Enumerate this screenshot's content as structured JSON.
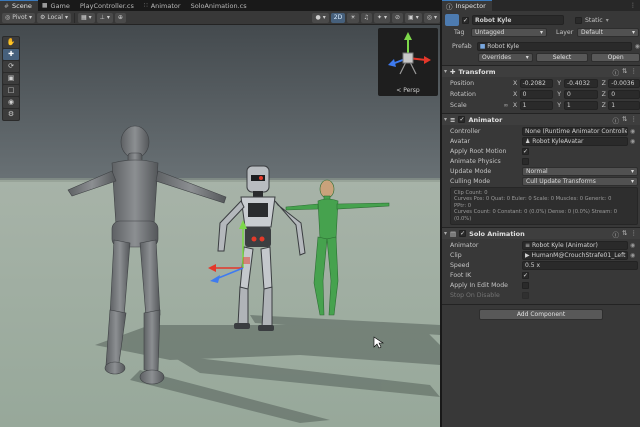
{
  "tabs": [
    {
      "label": "Scene",
      "icon": "#",
      "active": true
    },
    {
      "label": "Game",
      "icon": "■",
      "active": false
    },
    {
      "label": "PlayController.cs",
      "icon": "",
      "active": false
    },
    {
      "label": "Animator",
      "icon": "∷",
      "active": false
    },
    {
      "label": "SoloAnimation.cs",
      "icon": "",
      "active": false
    }
  ],
  "scene_toolbar": {
    "pivot": "Pivot",
    "local": "Local",
    "persp_label": "< Persp"
  },
  "inspector": {
    "tab_label": "Inspector",
    "object_name": "Robot Kyle",
    "static_label": "Static",
    "tag_label": "Tag",
    "tag_value": "Untagged",
    "layer_label": "Layer",
    "layer_value": "Default",
    "prefab_label": "Prefab",
    "prefab_value": "Robot Kyle",
    "overrides_label": "Overrides",
    "select_label": "Select",
    "open_label": "Open",
    "transform": {
      "title": "Transform",
      "position_label": "Position",
      "position": {
        "x": "-0.2082",
        "y": "-0.4032",
        "z": "-0.0036"
      },
      "rotation_label": "Rotation",
      "rotation": {
        "x": "0",
        "y": "0",
        "z": "0"
      },
      "scale_label": "Scale",
      "scale": {
        "x": "1",
        "y": "1",
        "z": "1"
      }
    },
    "animator": {
      "title": "Animator",
      "controller_label": "Controller",
      "controller_value": "None (Runtime Animator Controller)",
      "avatar_label": "Avatar",
      "avatar_value": "Robot KyleAvatar",
      "apply_root_motion_label": "Apply Root Motion",
      "apply_root_motion": true,
      "animate_physics_label": "Animate Physics",
      "animate_physics": false,
      "update_mode_label": "Update Mode",
      "update_mode_value": "Normal",
      "culling_mode_label": "Culling Mode",
      "culling_mode_value": "Cull Update Transforms",
      "info_lines": [
        "Clip Count: 0",
        "Curves Pos: 0 Quat: 0 Euler: 0 Scale: 0 Muscles: 0 Generic: 0",
        "PPtr: 0",
        "Curves Count: 0 Constant: 0 (0.0%) Dense: 0 (0.0%) Stream: 0",
        "(0.0%)"
      ]
    },
    "solo": {
      "title": "Solo Animation",
      "animator_label": "Animator",
      "animator_value": "Robot Kyle (Animator)",
      "clip_label": "Clip",
      "clip_value": "HumanM@CrouchStrafe01_Left",
      "speed_label": "Speed",
      "speed_value": "0.5 x",
      "foot_ik_label": "Foot IK",
      "foot_ik": true,
      "apply_in_edit_label": "Apply In Edit Mode",
      "apply_in_edit": false,
      "stop_on_disable_label": "Stop On Disable",
      "stop_on_disable": false
    },
    "add_component_label": "Add Component"
  },
  "colors": {
    "accent": "#3a79bb",
    "sky": "#4a5054",
    "ground": "#9fb0a2",
    "kyle_green": "#3fa24a"
  },
  "icons": {
    "transform": "move-arrows-icon",
    "animator": "animator-icon",
    "solo": "script-icon",
    "gizmo": "orientation-gizmo-icon",
    "mouse_cursor": "mouse-pointer-icon"
  }
}
